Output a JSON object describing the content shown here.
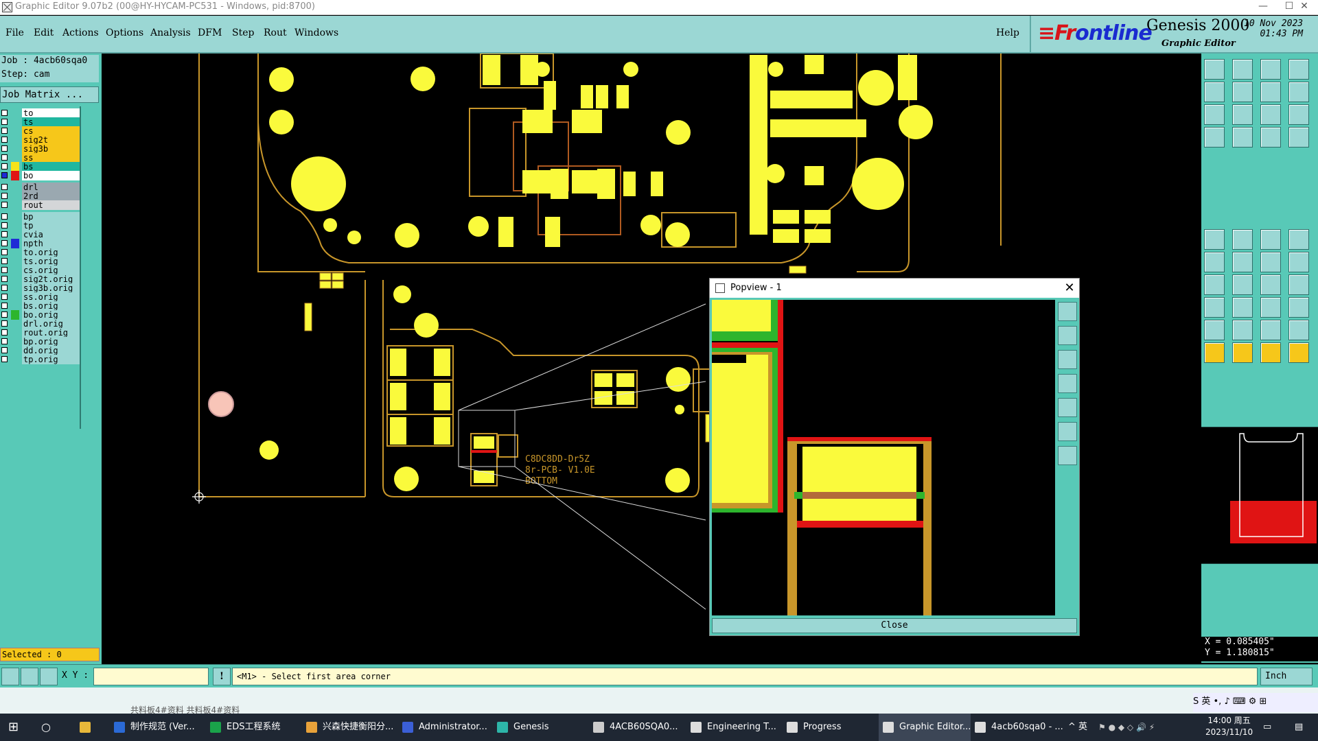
{
  "window": {
    "title": "Graphic Editor 9.07b2 (00@HY-HYCAM-PC531 - Windows, pid:8700)",
    "minimize": "—",
    "maximize": "☐",
    "close": "✕"
  },
  "menu": {
    "items": [
      "File",
      "Edit",
      "Actions",
      "Options",
      "Analysis",
      "DFM",
      "Step",
      "Rout",
      "Windows"
    ],
    "help": "Help"
  },
  "logo": {
    "brand_prefix": "Fr",
    "brand_rest": "ontline",
    "product": "Genesis 2000",
    "subtitle": "Graphic Editor",
    "date": "10 Nov 2023",
    "time": "01:43 PM"
  },
  "left": {
    "job": "Job : 4acb60sqa0",
    "step": "Step: cam",
    "job_matrix": "Job Matrix ...",
    "selected": "Selected : 0"
  },
  "layers": [
    {
      "name": "to",
      "bg": "#ffffff",
      "sw": ""
    },
    {
      "name": "ts",
      "bg": "#20b7a0",
      "sw": ""
    },
    {
      "name": "cs",
      "bg": "#f6c71a",
      "sw": ""
    },
    {
      "name": "sig2t",
      "bg": "#f6c71a",
      "sw": ""
    },
    {
      "name": "sig3b",
      "bg": "#f6c71a",
      "sw": ""
    },
    {
      "name": "ss",
      "bg": "#f6c71a",
      "sw": ""
    },
    {
      "name": "bs",
      "bg": "#20b7a0",
      "sw": "#f6e31a"
    },
    {
      "name": "bo",
      "bg": "#ffffff",
      "sw": "#e01414",
      "chk": "#1f2bd6"
    },
    {
      "name": "drl",
      "bg": "#9aa8b0",
      "sw": ""
    },
    {
      "name": "2rd",
      "bg": "#9aa8b0",
      "sw": ""
    },
    {
      "name": "rout",
      "bg": "#d4d6d8",
      "sw": ""
    },
    {
      "name": "bp",
      "bg": "#9bd7d4",
      "sw": ""
    },
    {
      "name": "tp",
      "bg": "#9bd7d4",
      "sw": ""
    },
    {
      "name": "cvia",
      "bg": "#9bd7d4",
      "sw": ""
    },
    {
      "name": "npth",
      "bg": "#9bd7d4",
      "sw": "#1f2bd6"
    },
    {
      "name": "to.orig",
      "bg": "#9bd7d4",
      "sw": ""
    },
    {
      "name": "ts.orig",
      "bg": "#9bd7d4",
      "sw": ""
    },
    {
      "name": "cs.orig",
      "bg": "#9bd7d4",
      "sw": ""
    },
    {
      "name": "sig2t.orig",
      "bg": "#9bd7d4",
      "sw": ""
    },
    {
      "name": "sig3b.orig",
      "bg": "#9bd7d4",
      "sw": ""
    },
    {
      "name": "ss.orig",
      "bg": "#9bd7d4",
      "sw": ""
    },
    {
      "name": "bs.orig",
      "bg": "#9bd7d4",
      "sw": ""
    },
    {
      "name": "bo.orig",
      "bg": "#9bd7d4",
      "sw": "#2db52d"
    },
    {
      "name": "drl.orig",
      "bg": "#9bd7d4",
      "sw": ""
    },
    {
      "name": "rout.orig",
      "bg": "#9bd7d4",
      "sw": ""
    },
    {
      "name": "bp.orig",
      "bg": "#9bd7d4",
      "sw": ""
    },
    {
      "name": "dd.orig",
      "bg": "#9bd7d4",
      "sw": ""
    },
    {
      "name": "tp.orig",
      "bg": "#9bd7d4",
      "sw": ""
    }
  ],
  "canvas": {
    "silk_text": [
      "C8DC8DD-Dr5Z",
      "8r-PCB- V1.0E",
      "BOTTOM"
    ]
  },
  "popview": {
    "title": "Popview - 1",
    "close_x": "✕",
    "close_button": "Close"
  },
  "coords": {
    "x": "X = 0.085405\"",
    "y": "Y = 1.180815\""
  },
  "status": {
    "xy_label": "X Y :",
    "message": "<M1> - Select first area corner",
    "unit": "Inch",
    "excl": "!"
  },
  "strip": {
    "text": "共料板4#资料    共料板4#资料"
  },
  "ime": {
    "label": "S 英 •, ♪ ⌨ ⚙ ⊞"
  },
  "taskbar": {
    "items": [
      {
        "label": "制作规范 (Ver...",
        "color": "#2b6ad6"
      },
      {
        "label": "EDS工程系统",
        "color": "#1aa34a"
      },
      {
        "label": "兴森快捷衡阳分...",
        "color": "#e8a23a"
      },
      {
        "label": "Administrator...",
        "color": "#3b5fd6"
      },
      {
        "label": "Genesis",
        "color": "#2db5a8"
      },
      {
        "label": "4ACB60SQA0...",
        "color": "#cccccc"
      },
      {
        "label": "Engineering T...",
        "color": "#dddddd"
      },
      {
        "label": "Progress",
        "color": "#dddddd"
      },
      {
        "label": "Graphic Editor...",
        "color": "#dddddd"
      },
      {
        "label": "4acb60sqa0 - ...",
        "color": "#dddddd"
      }
    ],
    "tray": "^  英",
    "time": "14:00 周五",
    "date": "2023/11/10"
  }
}
